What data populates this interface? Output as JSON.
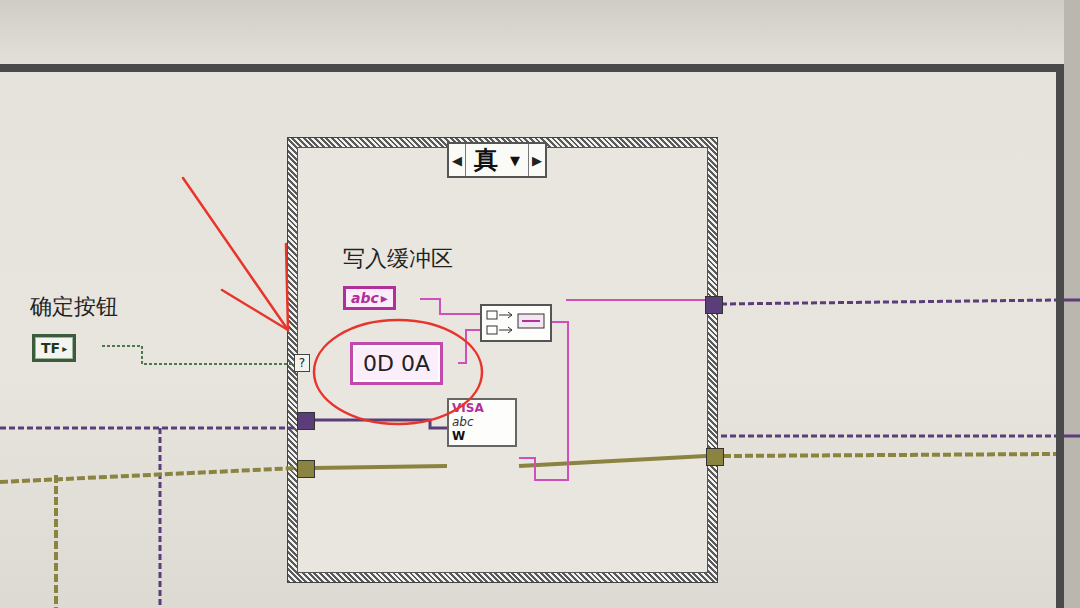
{
  "diagram": {
    "case_structure": {
      "selector": {
        "prev": "◀",
        "value": "真",
        "menu": "▼",
        "next": "▶"
      },
      "selector_terminal": "?"
    },
    "boolean_control": {
      "label": "确定按钮",
      "terminal": "TF"
    },
    "string_control": {
      "label": "写入缓冲区",
      "terminal": "abc",
      "arrow": "▸"
    },
    "string_constant": {
      "value": "0D 0A"
    },
    "visa_write": {
      "line1": "VISA",
      "line2": "abc",
      "line3": "W"
    },
    "annotations": [
      {
        "kind": "arrow",
        "color": "#e8352b"
      },
      {
        "kind": "circle",
        "color": "#e8352b"
      }
    ]
  }
}
